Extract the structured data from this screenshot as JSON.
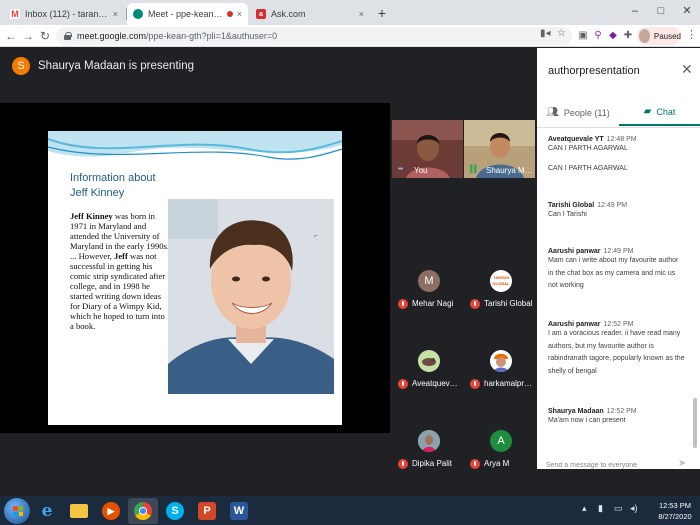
{
  "browser": {
    "tabs": [
      {
        "title": "Inbox (112) - tarannum@theindiv",
        "icon": "gmail-icon",
        "active": false,
        "close": "×"
      },
      {
        "title": "Meet - ppe-kean-gth",
        "icon": "meet-icon",
        "active": true,
        "close": "×"
      },
      {
        "title": "Ask.com",
        "icon": "ask-icon",
        "active": false,
        "close": "×"
      }
    ],
    "new_tab": "+",
    "window_controls": {
      "minimize": "–",
      "maximize": "□",
      "close": "✕"
    },
    "url_host": "meet.google.com",
    "url_path": "/ppe-kean-gth?pli=1&authuser=0",
    "profile_status": "Paused"
  },
  "meet": {
    "presenter_initial": "S",
    "presenter_text": "Shaurya Madaan is presenting",
    "slide": {
      "title": "Information about\nJeff Kinney",
      "body_bold_1": "Jeff Kinney",
      "body_1": " was born in 1971 in Maryland and attended the University of Maryland in the early 1990s. ... However, ",
      "body_bold_2": "Jeff",
      "body_2": " was not successful in getting his comic strip syndicated after college, and in 1998 he started writing down ideas for Diary of a Wimpy Kid, which he hoped to turn into a book."
    },
    "participants": [
      {
        "name": "You",
        "kind": "video",
        "muted": false
      },
      {
        "name": "Shaurya Mad...",
        "kind": "video",
        "muted": false
      },
      {
        "name": "Mehar Nagi",
        "kind": "avatar",
        "initial": "M",
        "color": "#8d6e63",
        "muted": true
      },
      {
        "name": "Tarishi Global",
        "kind": "avatar",
        "initial": "TARISHI GLOBAL",
        "color": "#ffffff",
        "muted": true
      },
      {
        "name": "Aveatquevale ...",
        "kind": "avatar",
        "initial": "",
        "color": "#c5e1a5",
        "muted": true
      },
      {
        "name": "harkamalpree...",
        "kind": "avatar",
        "initial": "",
        "color": "#ffcc80",
        "muted": true
      },
      {
        "name": "Dipika Palit",
        "kind": "avatar",
        "initial": "",
        "color": "#90a4ae",
        "muted": true
      },
      {
        "name": "Arya M",
        "kind": "avatar",
        "initial": "A",
        "color": "#1e8e3e",
        "muted": true
      }
    ]
  },
  "panel": {
    "title": "authorpresentation",
    "close_icon": "✕",
    "tab_people": "People (11)",
    "tab_chat": "Chat",
    "messages": [
      {
        "sender": "Aveatquevale YT",
        "time": "12:48 PM",
        "lines": [
          "CAN I PARTH AGARWAL",
          "",
          "CAN I PARTH AGARWAL"
        ]
      },
      {
        "sender": "Tarishi Global",
        "time": "12:49 PM",
        "lines": [
          "Can I Tarishi"
        ]
      },
      {
        "sender": "Aarushi panwar",
        "time": "12:49 PM",
        "lines": [
          "Mam  can i write about my favourite author",
          "in the chat box as my camera and mic us",
          "not working"
        ]
      },
      {
        "sender": "Aarushi panwar",
        "time": "12:52 PM",
        "lines": [
          "I am a voracious  reader. ii have read many",
          "authors, but my favourite author is",
          "rabindranath tagore, popularly known as the",
          "shelly of bengal"
        ]
      },
      {
        "sender": "Shaurya Madaan",
        "time": "12:52 PM",
        "lines": [
          "Ma'am now i can present"
        ]
      }
    ],
    "compose_placeholder": "Send a message to everyone"
  },
  "taskbar": {
    "apps": [
      {
        "name": "internet-explorer-icon",
        "glyph": "e",
        "color": "#1e88e5"
      },
      {
        "name": "file-explorer-icon",
        "glyph": "",
        "color": "#f4c542"
      },
      {
        "name": "media-player-icon",
        "glyph": "▶",
        "color": "#e65100"
      },
      {
        "name": "chrome-icon",
        "glyph": "",
        "color": "#4caf50"
      },
      {
        "name": "skype-icon",
        "glyph": "S",
        "color": "#00aff0"
      },
      {
        "name": "powerpoint-icon",
        "glyph": "P",
        "color": "#d24726"
      },
      {
        "name": "word-icon",
        "glyph": "W",
        "color": "#2b579a"
      }
    ],
    "time": "12:53 PM",
    "date": "8/27/2020"
  }
}
